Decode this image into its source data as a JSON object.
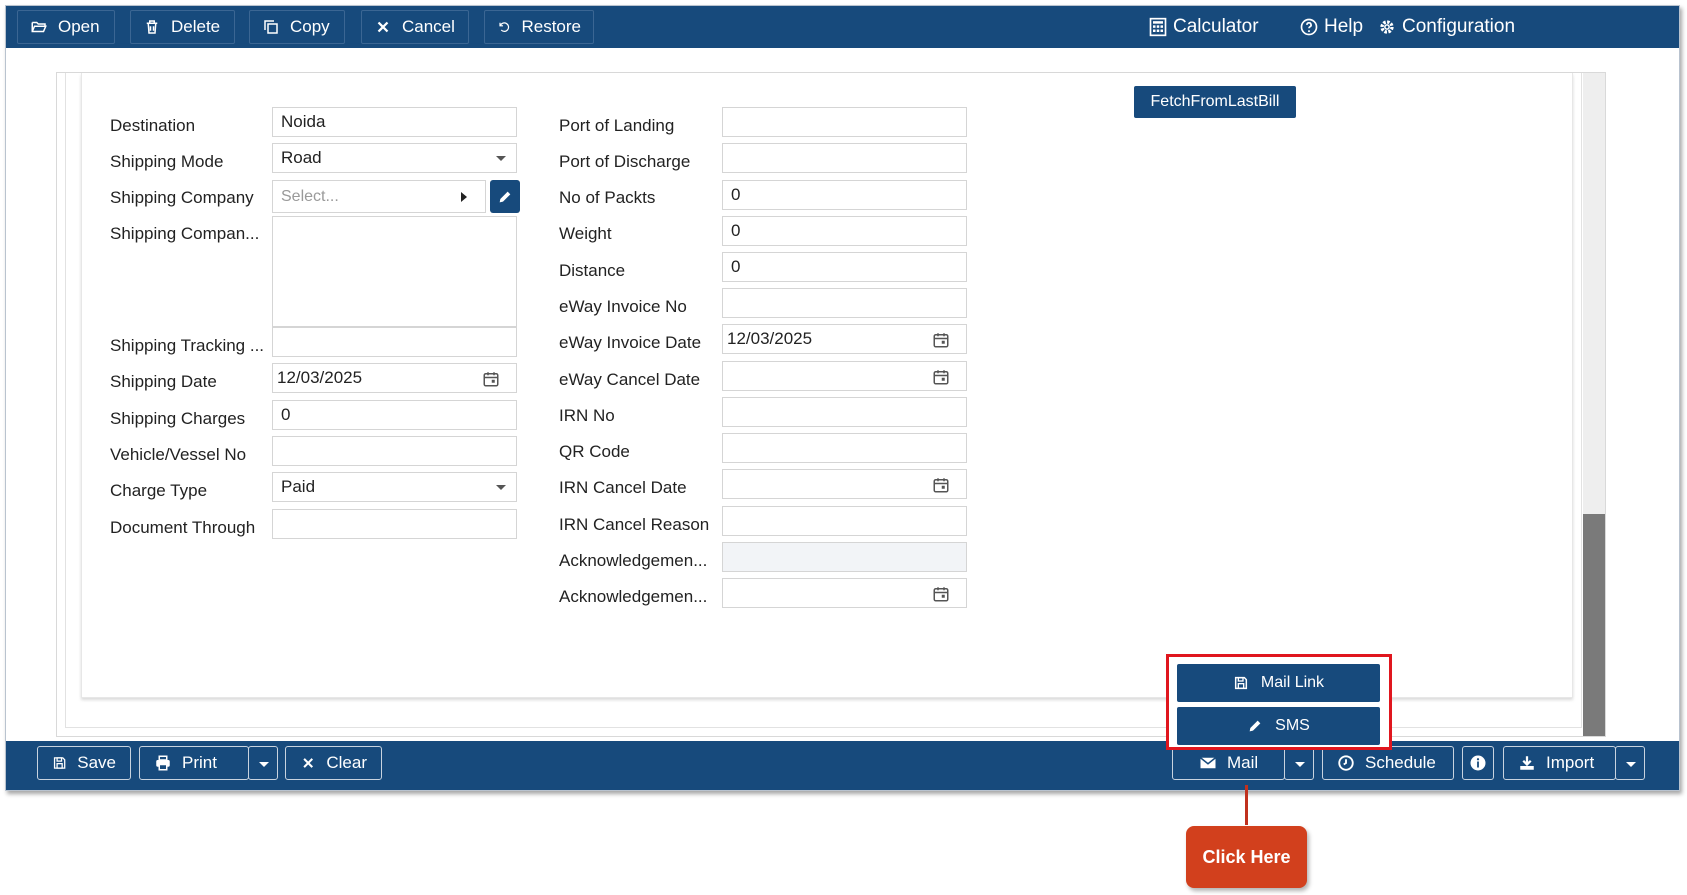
{
  "toolbar": {
    "open": "Open",
    "delete": "Delete",
    "copy": "Copy",
    "cancel": "Cancel",
    "restore": "Restore",
    "calculator": "Calculator",
    "help": "Help",
    "configuration": "Configuration"
  },
  "fetch_button": "FetchFromLastBill",
  "left_fields": {
    "destination": {
      "label": "Destination",
      "value": "Noida"
    },
    "shipping_mode": {
      "label": "Shipping Mode",
      "value": "Road"
    },
    "shipping_company": {
      "label": "Shipping Company",
      "placeholder": "Select..."
    },
    "shipping_company_address": {
      "label": "Shipping Compan...",
      "value": ""
    },
    "shipping_tracking": {
      "label": "Shipping Tracking ...",
      "value": ""
    },
    "shipping_date": {
      "label": "Shipping Date",
      "value": "12/03/2025"
    },
    "shipping_charges": {
      "label": "Shipping Charges",
      "value": "0"
    },
    "vehicle_no": {
      "label": "Vehicle/Vessel No",
      "value": ""
    },
    "charge_type": {
      "label": "Charge Type",
      "value": "Paid"
    },
    "document_through": {
      "label": "Document Through",
      "value": ""
    }
  },
  "right_fields": {
    "port_of_landing": {
      "label": "Port of Landing",
      "value": ""
    },
    "port_of_discharge": {
      "label": "Port of Discharge",
      "value": ""
    },
    "no_of_packts": {
      "label": "No of Packts",
      "value": "0"
    },
    "weight": {
      "label": "Weight",
      "value": "0"
    },
    "distance": {
      "label": "Distance",
      "value": "0"
    },
    "eway_invoice_no": {
      "label": "eWay Invoice No",
      "value": ""
    },
    "eway_invoice_date": {
      "label": "eWay Invoice Date",
      "value": "12/03/2025"
    },
    "eway_cancel_date": {
      "label": "eWay Cancel Date",
      "value": ""
    },
    "irn_no": {
      "label": "IRN No",
      "value": ""
    },
    "qr_code": {
      "label": "QR Code",
      "value": ""
    },
    "irn_cancel_date": {
      "label": "IRN Cancel Date",
      "value": ""
    },
    "irn_cancel_reason": {
      "label": "IRN Cancel Reason",
      "value": ""
    },
    "ack_no": {
      "label": "Acknowledgemen...",
      "value": ""
    },
    "ack_date": {
      "label": "Acknowledgemen...",
      "value": ""
    }
  },
  "bottombar": {
    "save": "Save",
    "print": "Print",
    "clear": "Clear",
    "mail": "Mail",
    "schedule": "Schedule",
    "import": "Import"
  },
  "mail_menu": {
    "mail_link": "Mail Link",
    "sms": "SMS"
  },
  "callout": "Click Here",
  "colors": {
    "brand": "#174a7c",
    "highlight": "#e0161e",
    "callout": "#d2401d"
  }
}
